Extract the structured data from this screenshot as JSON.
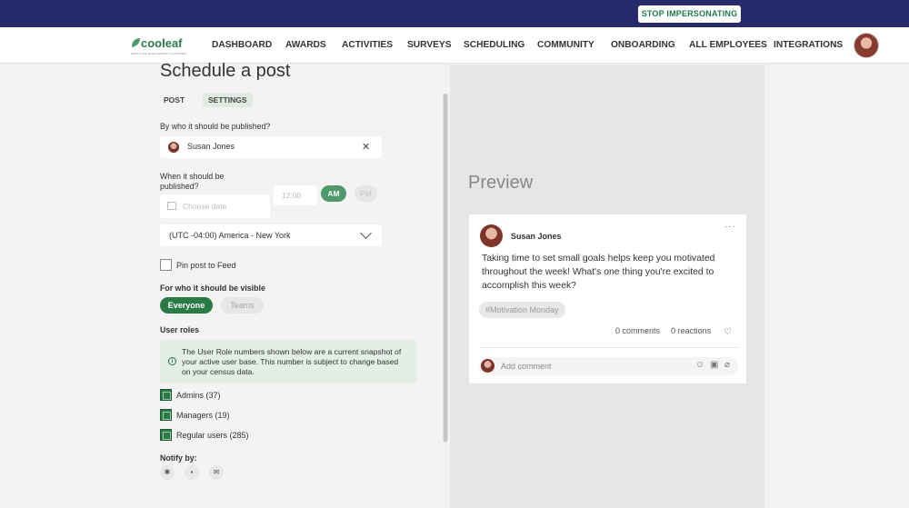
{
  "topbar": {
    "stop_label": "STOP IMPERSONATING"
  },
  "brand": {
    "name": "cooleaf",
    "tagline": "EMPLOYEE ENGAGEMENT PLATFORM"
  },
  "nav": {
    "items": [
      "DASHBOARD",
      "AWARDS",
      "ACTIVITIES",
      "SURVEYS",
      "SCHEDULING",
      "COMMUNITY",
      "ONBOARDING",
      "ALL EMPLOYEES",
      "INTEGRATIONS"
    ]
  },
  "page": {
    "title": "Schedule a post",
    "tabs": [
      {
        "label": "POST",
        "active": false
      },
      {
        "label": "SETTINGS",
        "active": true
      }
    ]
  },
  "form": {
    "publisher_label": "By who it should be published?",
    "publisher_name": "Susan Jones",
    "when_label_line1": "When it should be",
    "when_label_line2": "published?",
    "date_placeholder": "Choose date",
    "time_value": "12:00",
    "am_label": "AM",
    "pm_label": "PM",
    "timezone": "(UTC -04:00) America - New York",
    "pin_label": "Pin post to Feed",
    "visibility_label": "For who it should be visible",
    "visibility_options": [
      "Everyone",
      "Teams"
    ],
    "user_roles_label": "User roles",
    "info_text": "The User Role numbers shown below are a current snapshot of your active user base. This number is subject to change based on your census data.",
    "roles": [
      {
        "label": "Admins (37)",
        "checked": true
      },
      {
        "label": "Managers (19)",
        "checked": true
      },
      {
        "label": "Regular users (285)",
        "checked": true
      }
    ],
    "notify_label": "Notify by:",
    "notify_icons": [
      "slack-icon",
      "teams-icon",
      "email-icon"
    ]
  },
  "preview": {
    "title": "Preview",
    "author": "Susan Jones",
    "body": "Taking time to set small goals helps keep you motivated throughout the week! What's one thing you're excited to accomplish this week?",
    "hashtag": "#Motivation Monday",
    "comments": "0 comments",
    "reactions": "0 reactions",
    "comment_placeholder": "Add comment"
  },
  "colors": {
    "header": "#272a6b",
    "accent": "#2a7a46"
  }
}
